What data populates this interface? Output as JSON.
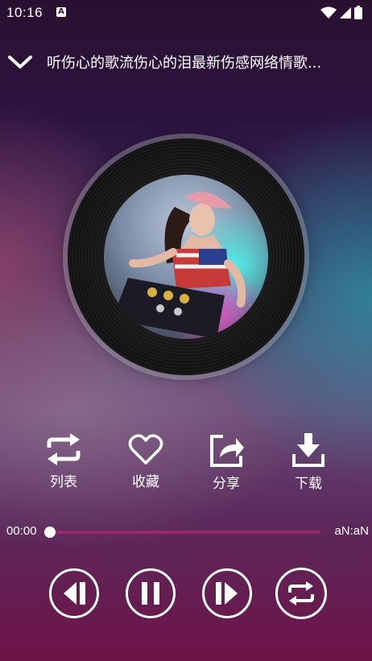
{
  "status_bar": {
    "time": "10:16",
    "app_icon_letter": "A",
    "icons": [
      "wifi-icon",
      "signal-icon",
      "battery-icon"
    ]
  },
  "header": {
    "collapse_icon": "chevron-down-icon",
    "title": "听伤心的歌流伤心的泪最新伤感网络情歌..."
  },
  "album_art": {
    "icon": "vinyl-disc"
  },
  "actions": [
    {
      "label": "列表",
      "icon": "repeat-arrows-icon"
    },
    {
      "label": "收藏",
      "icon": "heart-icon"
    },
    {
      "label": "分享",
      "icon": "share-icon"
    },
    {
      "label": "下载",
      "icon": "download-icon"
    }
  ],
  "progress": {
    "current_time": "00:00",
    "total_time": "aN:aN",
    "fraction": 0
  },
  "controls": {
    "previous_icon": "previous-icon",
    "pause_icon": "pause-icon",
    "next_icon": "next-icon",
    "repeat_icon": "repeat-icon"
  },
  "colors": {
    "accent": "#a0286e",
    "icon": "#ffffff"
  }
}
